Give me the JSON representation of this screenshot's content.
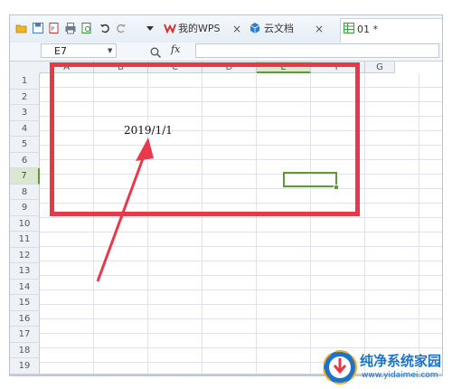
{
  "toolbar": {
    "quick_access": [
      "open-icon",
      "save-icon",
      "export-icon",
      "print-icon",
      "preview-icon",
      "undo-icon",
      "redo-icon",
      "dropdown-icon"
    ],
    "tabs": [
      {
        "label": "我的WPS",
        "icon": "wps-logo-icon",
        "closable": true
      },
      {
        "label": "云文档",
        "icon": "cloud-doc-icon",
        "closable": true
      },
      {
        "label": "01 *",
        "icon": "spreadsheet-icon",
        "active": true
      }
    ],
    "close_glyph": "×"
  },
  "formula_bar": {
    "name_box": "E7",
    "fx_label": "fx",
    "formula": ""
  },
  "sheet": {
    "columns": [
      "A",
      "B",
      "C",
      "D",
      "E",
      "F",
      "G"
    ],
    "rows": [
      "1",
      "2",
      "3",
      "4",
      "5",
      "6",
      "7",
      "8",
      "9",
      "10",
      "11",
      "12",
      "13",
      "14",
      "15",
      "16",
      "17",
      "18",
      "19"
    ],
    "selected_column": "E",
    "selected_row": "7",
    "cells": {
      "B3": "2019/1/1"
    }
  },
  "annotation": {
    "color": "#e8394a"
  },
  "watermark": {
    "title": "纯净系统家园",
    "url": "www.yidaimei.com"
  },
  "colors": {
    "selection": "#5f9a38",
    "accent": "#e8394a",
    "brand": "#1e73c8"
  }
}
